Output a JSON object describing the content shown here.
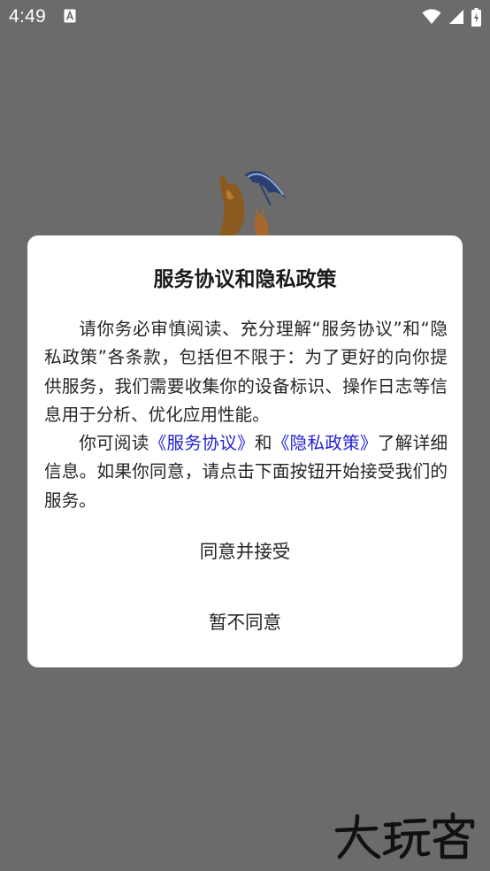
{
  "status_bar": {
    "time": "4:49",
    "notification_icon": "accessibility-app-icon",
    "wifi_icon": "wifi-icon",
    "signal_icon": "cellular-signal-icon",
    "battery_icon": "battery-charging-icon"
  },
  "background": {
    "splash_icon": "kangaroo-umbrella-logo"
  },
  "dialog": {
    "title": "服务协议和隐私政策",
    "paragraph1": "请你务必审慎阅读、充分理解“服务协议”和“隐私政策”各条款，包括但不限于：为了更好的向你提供服务，我们需要收集你的设备标识、操作日志等信息用于分析、优化应用性能。",
    "p2_prefix": "你可阅读",
    "service_link": "《服务协议》",
    "p2_and": "和",
    "privacy_link": "《隐私政策》",
    "p2_suffix": "了解详细信息。如果你同意，请点击下面按钮开始接受我们的服务。",
    "agree_button": "同意并接受",
    "disagree_button": "暂不同意"
  },
  "watermark": {
    "text": "大玩客"
  },
  "colors": {
    "overlay": "#6b6b6b",
    "dialog_bg": "#ffffff",
    "link": "#2323d6",
    "text": "#262626"
  }
}
